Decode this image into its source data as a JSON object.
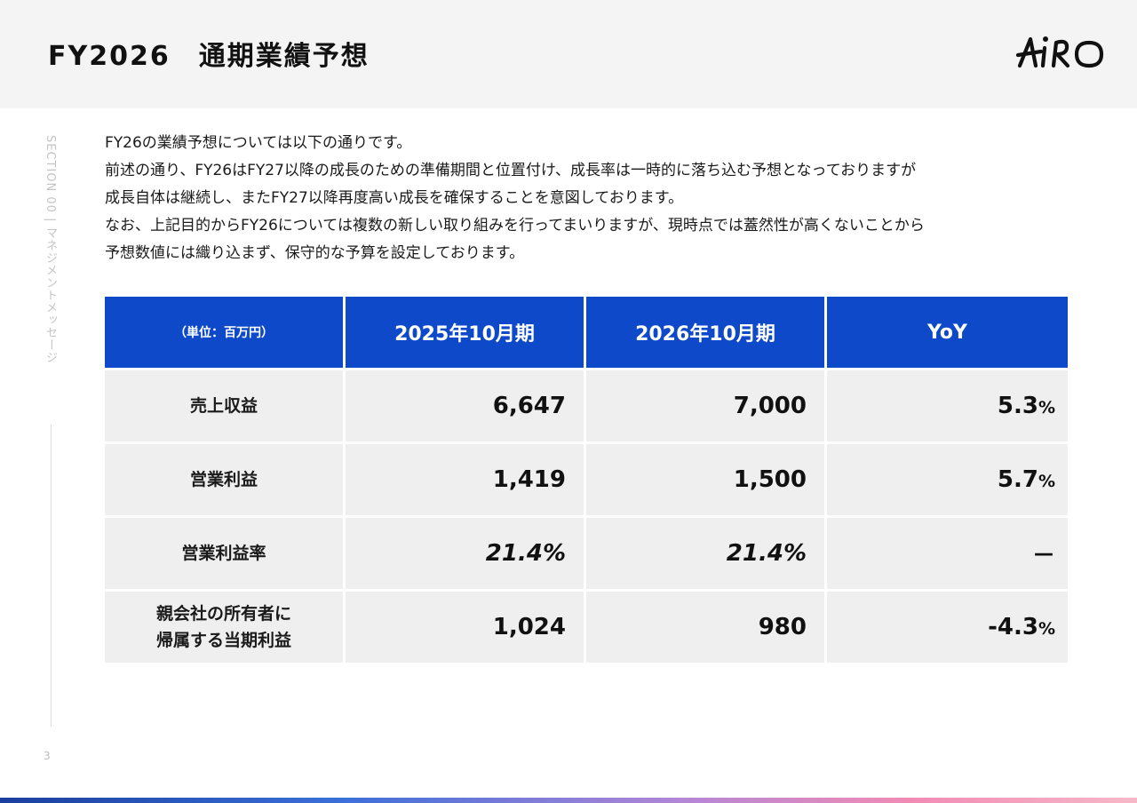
{
  "header": {
    "title": "FY2026　通期業績予想",
    "logo_text": "AIRO"
  },
  "sidebar": {
    "section_label": "SECTION 00 | マネジメントメッセージ",
    "page_number": "3"
  },
  "intro": {
    "lines": [
      "FY26の業績予想については以下の通りです。",
      "前述の通り、FY26はFY27以降の成長のための準備期間と位置付け、成長率は一時的に落ち込む予想となっておりますが",
      "成長自体は継続し、またFY27以降再度高い成長を確保することを意図しております。",
      "なお、上記目的からFY26については複数の新しい取り組みを行ってまいりますが、現時点では蓋然性が高くないことから",
      "予想数値には織り込まず、保守的な予算を設定しております。"
    ]
  },
  "table": {
    "header": {
      "unit": "（単位：百万円）",
      "col_2025": "2025年10月期",
      "col_2026": "2026年10月期",
      "col_yoy": "YoY"
    },
    "rows": [
      {
        "label_line1": "売上収益",
        "label_line2": "",
        "fy2025": "6,647",
        "fy2026": "7,000",
        "yoy_value": "5.3",
        "yoy_unit": "%"
      },
      {
        "label_line1": "営業利益",
        "label_line2": "",
        "fy2025": "1,419",
        "fy2026": "1,500",
        "yoy_value": "5.7",
        "yoy_unit": "%"
      },
      {
        "label_line1": "営業利益率",
        "label_line2": "",
        "fy2025": "21.4%",
        "fy2026": "21.4%",
        "yoy_value": "－",
        "yoy_unit": ""
      },
      {
        "label_line1": "親会社の所有者に",
        "label_line2": "帰属する当期利益",
        "fy2025": "1,024",
        "fy2026": "980",
        "yoy_value": "-4.3",
        "yoy_unit": "%"
      }
    ]
  },
  "colors": {
    "header_bg": "#f4f4f4",
    "table_header_bg": "#0d49c9",
    "table_cell_bg": "#efefef"
  }
}
